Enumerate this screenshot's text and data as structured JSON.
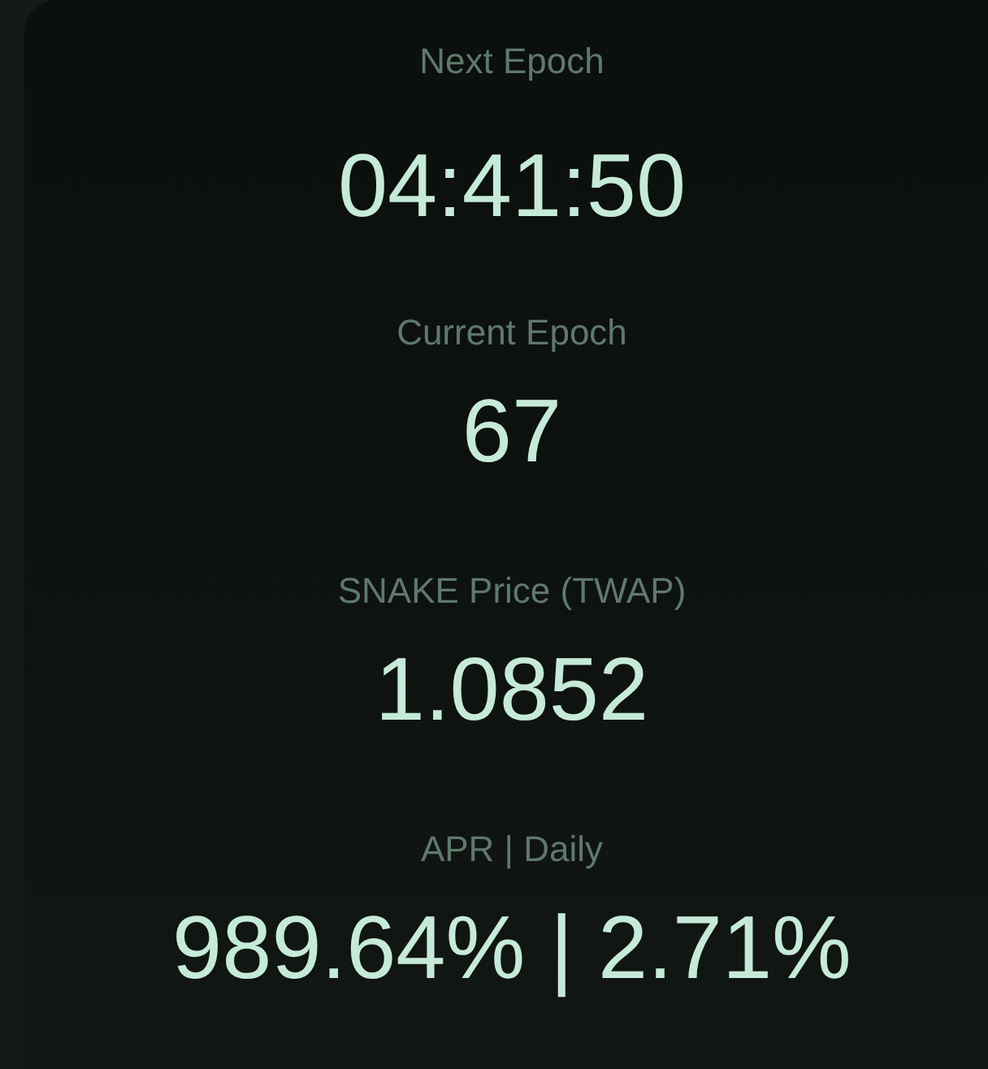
{
  "stats": [
    {
      "kind": "countdown",
      "label": "Next Epoch",
      "value": "04:41:50"
    },
    {
      "kind": "plain",
      "label": "Current Epoch",
      "value": "67"
    },
    {
      "kind": "plain",
      "label": "SNAKE Price (TWAP)",
      "value": "1.0852"
    },
    {
      "kind": "plain",
      "label": "APR | Daily",
      "value": "989.64% | 2.71%"
    }
  ]
}
